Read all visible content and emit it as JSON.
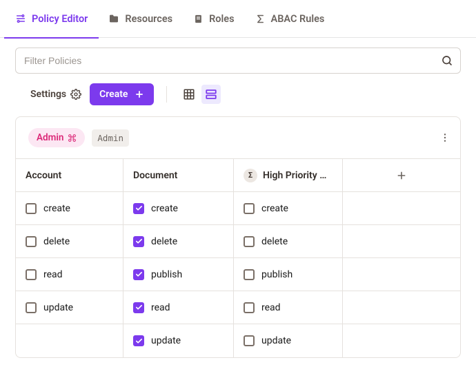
{
  "tabs": [
    {
      "label": "Policy Editor",
      "icon": "policy-editor"
    },
    {
      "label": "Resources",
      "icon": "resources"
    },
    {
      "label": "Roles",
      "icon": "roles"
    },
    {
      "label": "ABAC Rules",
      "icon": "abac"
    }
  ],
  "active_tab": 0,
  "search": {
    "placeholder": "Filter Policies",
    "value": ""
  },
  "toolbar": {
    "settings_label": "Settings",
    "create_label": "Create"
  },
  "view_mode": "list",
  "role_header": {
    "chip_label": "Admin",
    "plain_label": "Admin"
  },
  "columns": [
    {
      "label": "Account",
      "type": "plain"
    },
    {
      "label": "Document",
      "type": "plain"
    },
    {
      "label": "High Priority …",
      "type": "derived"
    }
  ],
  "rows": [
    {
      "cells": [
        {
          "label": "create",
          "checked": false
        },
        {
          "label": "create",
          "checked": true
        },
        {
          "label": "create",
          "checked": false
        }
      ]
    },
    {
      "cells": [
        {
          "label": "delete",
          "checked": false
        },
        {
          "label": "delete",
          "checked": true
        },
        {
          "label": "delete",
          "checked": false
        }
      ]
    },
    {
      "cells": [
        {
          "label": "read",
          "checked": false
        },
        {
          "label": "publish",
          "checked": true
        },
        {
          "label": "publish",
          "checked": false
        }
      ]
    },
    {
      "cells": [
        {
          "label": "update",
          "checked": false
        },
        {
          "label": "read",
          "checked": true
        },
        {
          "label": "read",
          "checked": false
        }
      ]
    },
    {
      "cells": [
        null,
        {
          "label": "update",
          "checked": true
        },
        {
          "label": "update",
          "checked": false
        }
      ]
    }
  ]
}
